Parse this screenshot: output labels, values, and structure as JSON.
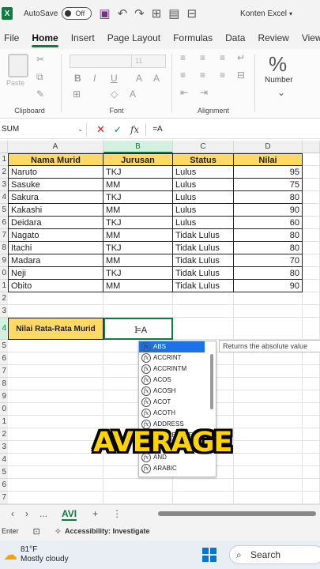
{
  "titlebar": {
    "app_icon": "X",
    "autosave_label": "AutoSave",
    "autosave_state": "Off",
    "doc_title": "Konten Excel"
  },
  "ribbon_tabs": [
    "File",
    "Home",
    "Insert",
    "Page Layout",
    "Formulas",
    "Data",
    "Review",
    "View"
  ],
  "ribbon": {
    "paste_label": "Paste",
    "font_size": "11",
    "clipboard_label": "Clipboard",
    "font_label": "Font",
    "alignment_label": "Alignment",
    "number_label": "Number",
    "percent_glyph": "%"
  },
  "formula_bar": {
    "name_box": "SUM",
    "formula": "=A"
  },
  "columns": [
    "A",
    "B",
    "C",
    "D"
  ],
  "row_numbers": [
    "1",
    "2",
    "3",
    "4",
    "5",
    "6",
    "7",
    "8",
    "9",
    "0",
    "1",
    "2",
    "3",
    "4",
    "5",
    "6",
    "7",
    "8",
    "9",
    "0",
    "1",
    "2",
    "3",
    "4",
    "5",
    "6",
    "7"
  ],
  "table": {
    "headers": [
      "Nama Murid",
      "Jurusan",
      "Status",
      "Nilai"
    ],
    "rows": [
      [
        "Naruto",
        "TKJ",
        "Lulus",
        "95"
      ],
      [
        "Sasuke",
        "MM",
        "Lulus",
        "75"
      ],
      [
        "Sakura",
        "TKJ",
        "Lulus",
        "80"
      ],
      [
        "Kakashi",
        "MM",
        "Lulus",
        "90"
      ],
      [
        "Deidara",
        "TKJ",
        "Lulus",
        "60"
      ],
      [
        "Nagato",
        "MM",
        "Tidak Lulus",
        "80"
      ],
      [
        "Itachi",
        "TKJ",
        "Tidak Lulus",
        "80"
      ],
      [
        "Madara",
        "MM",
        "Tidak Lulus",
        "70"
      ],
      [
        "Neji",
        "TKJ",
        "Tidak Lulus",
        "80"
      ],
      [
        "Obito",
        "MM",
        "Tidak Lulus",
        "90"
      ]
    ]
  },
  "summary": {
    "label": "Nilai Rata-Rata Murid",
    "input": "=A"
  },
  "autocomplete": {
    "items": [
      "ABS",
      "ACCRINT",
      "ACCRINTM",
      "ACOS",
      "ACOSH",
      "ACOT",
      "ACOTH",
      "ADDRESS",
      "AGGREGATE",
      "AMORDEGRC",
      "AND",
      "ARABIC"
    ],
    "tooltip": "Returns the absolute value"
  },
  "caption": "AVERAGE",
  "sheetbar": {
    "sheet_name": "AVI",
    "more": "...",
    "add": "+"
  },
  "statusbar": {
    "mode": "Enter",
    "accessibility": "Accessibility: Investigate"
  },
  "taskbar": {
    "temp": "81°F",
    "weather": "Mostly cloudy",
    "search": "Search"
  }
}
